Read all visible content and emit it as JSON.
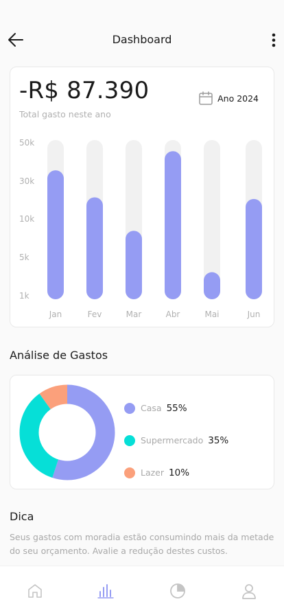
{
  "header": {
    "title": "Dashboard",
    "back_icon": "arrow-left-icon",
    "menu_icon": "more-vertical-icon"
  },
  "summary": {
    "amount": "-R$ 87.390",
    "subtitle": "Total gasto neste ano",
    "year_label": "Ano 2024",
    "year_icon": "calendar-icon"
  },
  "colors": {
    "accent": "#959cf3",
    "track": "#f1f1f1",
    "casa": "#959cf3",
    "supermercado": "#06dfd7",
    "lazer": "#fba07b"
  },
  "chart_data": {
    "type": "bar",
    "categories": [
      "Jan",
      "Fev",
      "Mar",
      "Abr",
      "Mai",
      "Jun"
    ],
    "ytick_labels": [
      "50k",
      "30k",
      "10k",
      "5k",
      "1k"
    ],
    "values": [
      0.81,
      0.64,
      0.43,
      0.93,
      0.17,
      0.63
    ],
    "value_scale": "fraction of track height",
    "grid": false,
    "legend": "none"
  },
  "analysis": {
    "title": "Análise de Gastos",
    "items": [
      {
        "label": "Casa",
        "percent": "55%",
        "value": 55,
        "color": "#959cf3"
      },
      {
        "label": "Supermercado",
        "percent": "35%",
        "value": 35,
        "color": "#06dfd7"
      },
      {
        "label": "Lazer",
        "percent": "10%",
        "value": 10,
        "color": "#fba07b"
      }
    ]
  },
  "tip": {
    "title": "Dica",
    "text": "Seus gastos com moradia estão consumindo mais da metade do seu orçamento. Avalie a redução destes custos."
  },
  "tabbar": {
    "items": [
      {
        "icon": "home-icon",
        "active": false
      },
      {
        "icon": "bar-chart-icon",
        "active": true
      },
      {
        "icon": "pie-chart-icon",
        "active": false
      },
      {
        "icon": "user-icon",
        "active": false
      }
    ]
  }
}
